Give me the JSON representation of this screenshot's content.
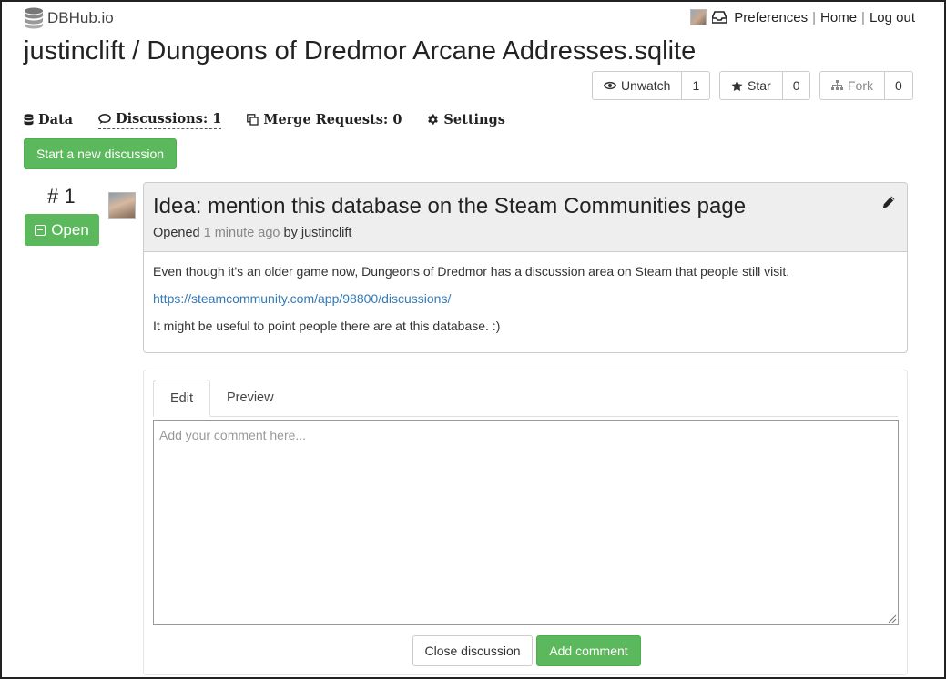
{
  "header": {
    "brand": "DBHub.io",
    "nav": {
      "preferences": "Preferences",
      "home": "Home",
      "logout": "Log out",
      "separator": "|"
    }
  },
  "page": {
    "title": "justinclift / Dungeons of Dredmor Arcane Addresses.sqlite"
  },
  "actions": {
    "watch": {
      "label": "Unwatch",
      "count": "1"
    },
    "star": {
      "label": "Star",
      "count": "0"
    },
    "fork": {
      "label": "Fork",
      "count": "0"
    }
  },
  "tabs": {
    "data": "Data",
    "discussions": "Discussions: 1",
    "merge_requests": "Merge Requests: 0",
    "settings": "Settings"
  },
  "new_discussion_label": "Start a new discussion",
  "discussion": {
    "number": "# 1",
    "status": "Open",
    "title": "Idea: mention this database on the Steam Communities page",
    "opened_prefix": "Opened",
    "opened_time": "1 minute ago",
    "opened_by": "by justinclift",
    "body": {
      "line1": "Even though it's an older game now, Dungeons of Dredmor has a discussion area on Steam that people still visit.",
      "link": "https://steamcommunity.com/app/98800/discussions/",
      "line3": "It might be useful to point people there are at this database. :)"
    }
  },
  "comment": {
    "tabs": {
      "edit": "Edit",
      "preview": "Preview"
    },
    "placeholder": "Add your comment here...",
    "close_label": "Close discussion",
    "add_label": "Add comment"
  },
  "colors": {
    "accent_green": "#5cb85c",
    "link_blue": "#337ab7",
    "panel_header": "#eeeeee"
  },
  "icons": [
    "database-icon",
    "inbox-icon",
    "eye-icon",
    "star-icon",
    "fork-icon",
    "comment-icon",
    "copy-icon",
    "gear-icon",
    "pencil-icon",
    "minus-square-icon"
  ]
}
